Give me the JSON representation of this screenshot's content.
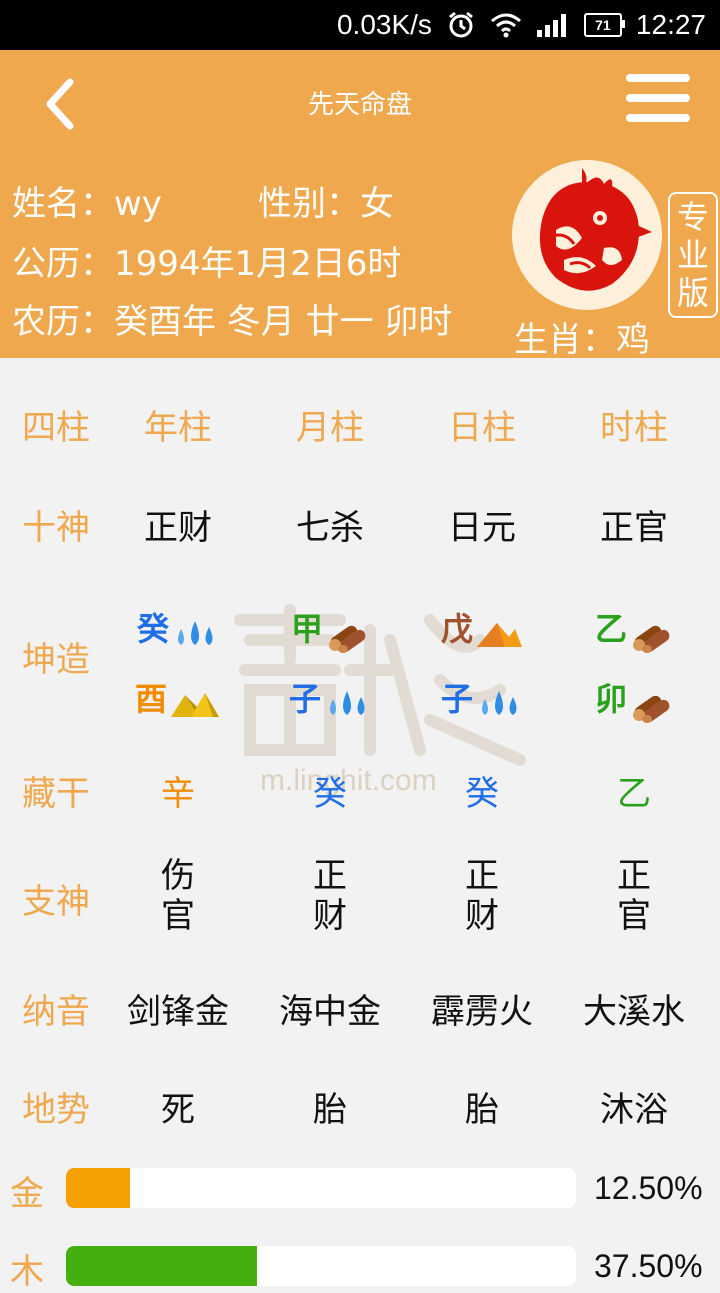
{
  "status_bar": {
    "speed": "0.03K/s",
    "battery": "71",
    "time": "12:27"
  },
  "header": {
    "title": "先天命盘"
  },
  "profile": {
    "name": "姓名：wy",
    "gender": "性别：女",
    "solar": "公历：1994年1月2日6时",
    "lunar": "农历：癸酉年 冬月 廿一 卯时",
    "zodiac": "生肖：鸡",
    "pro_badge": "专业版"
  },
  "table": {
    "header": {
      "label": "四柱",
      "cols": [
        "年柱",
        "月柱",
        "日柱",
        "时柱"
      ]
    },
    "shishen": {
      "label": "十神",
      "cols": [
        "正财",
        "七杀",
        "日元",
        "正官"
      ]
    },
    "kunzao": {
      "label": "坤造",
      "stems": [
        {
          "char": "癸",
          "color": "#1f6ee8",
          "icon": "water"
        },
        {
          "char": "甲",
          "color": "#2aa11d",
          "icon": "wood"
        },
        {
          "char": "戊",
          "color": "#a0522d",
          "icon": "earth"
        },
        {
          "char": "乙",
          "color": "#2aa11d",
          "icon": "wood"
        }
      ],
      "branches": [
        {
          "char": "酉",
          "color": "#f08c00",
          "icon": "metal"
        },
        {
          "char": "子",
          "color": "#1f6ee8",
          "icon": "water"
        },
        {
          "char": "子",
          "color": "#1f6ee8",
          "icon": "water"
        },
        {
          "char": "卯",
          "color": "#2aa11d",
          "icon": "wood"
        }
      ]
    },
    "canggan": {
      "label": "藏干",
      "cols": [
        {
          "text": "辛",
          "color": "#f08c00"
        },
        {
          "text": "癸",
          "color": "#1f6ee8"
        },
        {
          "text": "癸",
          "color": "#1f6ee8"
        },
        {
          "text": "乙",
          "color": "#2aa11d"
        }
      ]
    },
    "zhishen": {
      "label": "支神",
      "cols": [
        [
          "伤",
          "官"
        ],
        [
          "正",
          "财"
        ],
        [
          "正",
          "财"
        ],
        [
          "正",
          "官"
        ]
      ]
    },
    "nayin": {
      "label": "纳音",
      "cols": [
        "剑锋金",
        "海中金",
        "霹雳火",
        "大溪水"
      ]
    },
    "dishi": {
      "label": "地势",
      "cols": [
        "死",
        "胎",
        "胎",
        "沐浴"
      ]
    }
  },
  "watermark": {
    "url": "m.linghit.com"
  },
  "elements": [
    {
      "label": "金",
      "percent_text": "12.50%",
      "fraction": 0.125,
      "color": "#f5a000"
    },
    {
      "label": "木",
      "percent_text": "37.50%",
      "fraction": 0.375,
      "color": "#44b010"
    }
  ]
}
